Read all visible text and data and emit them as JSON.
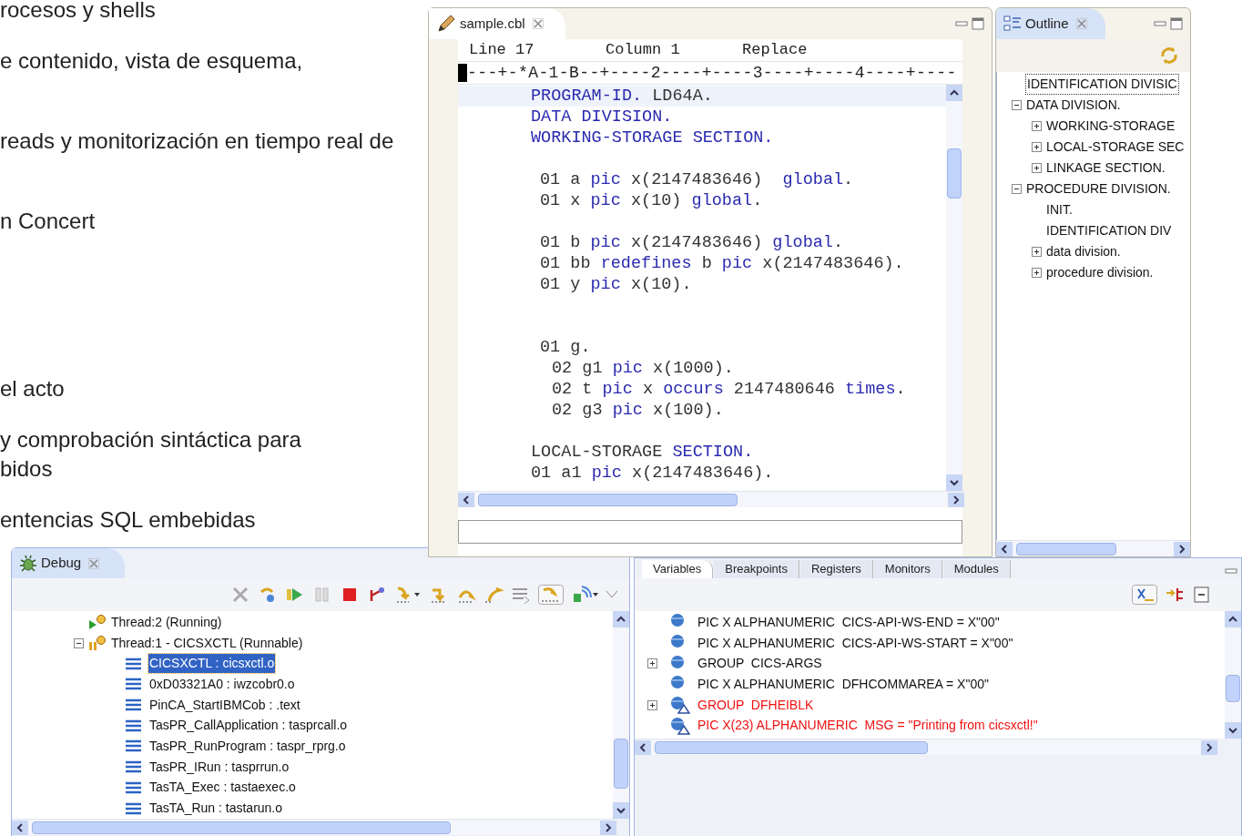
{
  "slide_text": [
    "rocesos y shells",
    "e contenido, vista de esquema,",
    "reads y monitorización en tiempo real de",
    "n Concert",
    "el acto",
    "y comprobación sintáctica para",
    "bidos",
    "entencias SQL embebidas"
  ],
  "editor": {
    "tab": {
      "title": "sample.cbl",
      "selected": true
    },
    "status": [
      "Line 17",
      "Column 1",
      "Replace"
    ],
    "ruler": "---+-*A-1-B--+----2----+----3----+----4----+----",
    "lines": [
      {
        "kind": "division",
        "highlighted": true,
        "segments": [
          {
            "text": "PROGRAM-ID.",
            "keyword": true
          },
          {
            "text": " LD64A.",
            "keyword": false
          }
        ]
      },
      {
        "kind": "division",
        "highlighted": false,
        "segments": [
          {
            "text": "DATA DIVISION.",
            "keyword": true
          }
        ]
      },
      {
        "kind": "division",
        "highlighted": false,
        "segments": [
          {
            "text": "WORKING-STORAGE SECTION.",
            "keyword": true
          }
        ]
      },
      {
        "kind": "blank"
      },
      {
        "kind": "entry",
        "highlighted": false,
        "segments": [
          {
            "text": "01 a ",
            "keyword": false
          },
          {
            "text": "pic",
            "keyword": true
          },
          {
            "text": " x(2147483646)  ",
            "keyword": false
          },
          {
            "text": "global",
            "keyword": true
          },
          {
            "text": ".",
            "keyword": false
          }
        ]
      },
      {
        "kind": "entry",
        "highlighted": false,
        "segments": [
          {
            "text": "01 x ",
            "keyword": false
          },
          {
            "text": "pic",
            "keyword": true
          },
          {
            "text": " x(10) ",
            "keyword": false
          },
          {
            "text": "global",
            "keyword": true
          },
          {
            "text": ".",
            "keyword": false
          }
        ]
      },
      {
        "kind": "blank"
      },
      {
        "kind": "entry",
        "highlighted": false,
        "segments": [
          {
            "text": "01 b ",
            "keyword": false
          },
          {
            "text": "pic",
            "keyword": true
          },
          {
            "text": " x(2147483646) ",
            "keyword": false
          },
          {
            "text": "global",
            "keyword": true
          },
          {
            "text": ".",
            "keyword": false
          }
        ]
      },
      {
        "kind": "entry",
        "highlighted": false,
        "segments": [
          {
            "text": "01 bb ",
            "keyword": false
          },
          {
            "text": "redefines",
            "keyword": true
          },
          {
            "text": " b ",
            "keyword": false
          },
          {
            "text": "pic",
            "keyword": true
          },
          {
            "text": " x(2147483646).",
            "keyword": false
          }
        ]
      },
      {
        "kind": "entry",
        "highlighted": false,
        "segments": [
          {
            "text": "01 y ",
            "keyword": false
          },
          {
            "text": "pic",
            "keyword": true
          },
          {
            "text": " x(10).",
            "keyword": false
          }
        ]
      },
      {
        "kind": "blank"
      },
      {
        "kind": "blank"
      },
      {
        "kind": "entry",
        "highlighted": false,
        "segments": [
          {
            "text": "01 g.",
            "keyword": false
          }
        ]
      },
      {
        "kind": "sub",
        "highlighted": false,
        "segments": [
          {
            "text": "02 g1 ",
            "keyword": false
          },
          {
            "text": "pic",
            "keyword": true
          },
          {
            "text": " x(1000).",
            "keyword": false
          }
        ]
      },
      {
        "kind": "sub",
        "highlighted": false,
        "segments": [
          {
            "text": "02 t ",
            "keyword": false
          },
          {
            "text": "pic",
            "keyword": true
          },
          {
            "text": " x ",
            "keyword": false
          },
          {
            "text": "occurs",
            "keyword": true
          },
          {
            "text": " 2147480646 ",
            "keyword": false
          },
          {
            "text": "times",
            "keyword": true
          },
          {
            "text": ".",
            "keyword": false
          }
        ]
      },
      {
        "kind": "sub",
        "highlighted": false,
        "segments": [
          {
            "text": "02 g3 ",
            "keyword": false
          },
          {
            "text": "pic",
            "keyword": true
          },
          {
            "text": " x(100).",
            "keyword": false
          }
        ]
      },
      {
        "kind": "blank"
      },
      {
        "kind": "division",
        "highlighted": false,
        "segments": [
          {
            "text": "LOCAL-STORAGE ",
            "keyword": false
          },
          {
            "text": "SECTION.",
            "keyword": true
          }
        ]
      },
      {
        "kind": "division",
        "highlighted": false,
        "segments": [
          {
            "text": "01 a1 ",
            "keyword": false
          },
          {
            "text": "pic",
            "keyword": true
          },
          {
            "text": " x(2147483646).",
            "keyword": false
          }
        ]
      }
    ]
  },
  "outline": {
    "tab": {
      "title": "Outline",
      "selected": true
    },
    "tree": [
      {
        "label": "IDENTIFICATION DIVISIC",
        "selected": true
      },
      {
        "label": "DATA DIVISION.",
        "selected": false,
        "expanded": true,
        "children": [
          {
            "label": "WORKING-STORAGE",
            "selected": false,
            "expanded": false
          },
          {
            "label": "LOCAL-STORAGE SEC",
            "selected": false,
            "expanded": false
          },
          {
            "label": "LINKAGE SECTION.",
            "selected": false,
            "expanded": false
          }
        ]
      },
      {
        "label": "PROCEDURE DIVISION.",
        "selected": false,
        "expanded": true,
        "children": [
          {
            "label": "INIT.",
            "selected": false
          },
          {
            "label": "IDENTIFICATION DIV",
            "selected": false
          },
          {
            "label": "data division.",
            "selected": false,
            "expanded": false
          },
          {
            "label": "procedure division.",
            "selected": false,
            "expanded": false
          }
        ]
      }
    ]
  },
  "debug": {
    "tab": {
      "title": "Debug",
      "selected": true
    },
    "tree": [
      {
        "label": "Thread:2 (Running)",
        "kind": "running",
        "selected": false
      },
      {
        "label": "Thread:1 - CICSXCTL (Runnable)",
        "kind": "suspended",
        "selected": false,
        "expanded": true,
        "children": [
          {
            "label": "CICSXCTL : cicsxctl.o",
            "selected": true
          },
          {
            "label": "0xD03321A0 : iwzcobr0.o",
            "selected": false
          },
          {
            "label": "PinCA_StartIBMCob : .text",
            "selected": false
          },
          {
            "label": "TasPR_CallApplication : tasprcall.o",
            "selected": false
          },
          {
            "label": "TasPR_RunProgram : taspr_rprg.o",
            "selected": false
          },
          {
            "label": "TasPR_IRun : tasprrun.o",
            "selected": false
          },
          {
            "label": "TasTA_Exec : tastaexec.o",
            "selected": false
          },
          {
            "label": "TasTA_Run : tastarun.o",
            "selected": false
          }
        ]
      }
    ]
  },
  "variables": {
    "tabs": [
      {
        "label": "Variables",
        "selected": true
      },
      {
        "label": "Breakpoints",
        "selected": false
      },
      {
        "label": "Registers",
        "selected": false
      },
      {
        "label": "Monitors",
        "selected": false
      },
      {
        "label": "Modules",
        "selected": false
      }
    ],
    "rows": [
      {
        "text": "PIC X ALPHANUMERIC  CICS-API-WS-END = X\"00\"",
        "kind": "normal"
      },
      {
        "text": "PIC X ALPHANUMERIC  CICS-API-WS-START = X\"00\"",
        "kind": "normal"
      },
      {
        "text": "GROUP  CICS-ARGS",
        "kind": "normal",
        "expanded": false
      },
      {
        "text": "PIC X ALPHANUMERIC  DFHCOMMAREA = X\"00\"",
        "kind": "normal"
      },
      {
        "text": "GROUP  DFHEIBLK",
        "kind": "changed",
        "expanded": false
      },
      {
        "text": "PIC X(23) ALPHANUMERIC  MSG = \"Printing from cicsxctl!\"",
        "kind": "changed"
      }
    ]
  }
}
